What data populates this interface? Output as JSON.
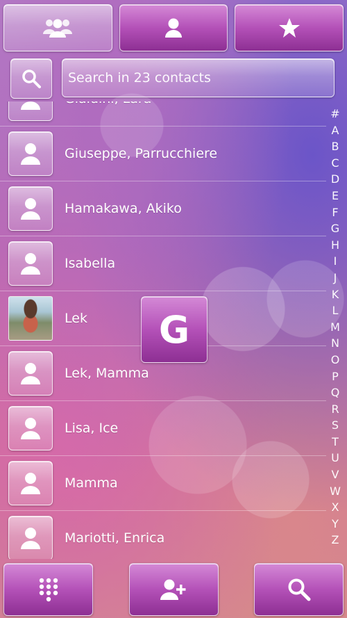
{
  "tabs": [
    {
      "icon": "groups-icon",
      "active": false
    },
    {
      "icon": "contact-icon",
      "active": true
    },
    {
      "icon": "star-icon",
      "active": false
    }
  ],
  "search": {
    "placeholder": "Search in 23 contacts",
    "value": ""
  },
  "contacts": [
    {
      "name": "Gialdini, Lara",
      "photo": false
    },
    {
      "name": "Giuseppe, Parrucchiere",
      "photo": false
    },
    {
      "name": "Hamakawa, Akiko",
      "photo": false
    },
    {
      "name": "Isabella",
      "photo": false
    },
    {
      "name": "Lek",
      "photo": true
    },
    {
      "name": "Lek, Mamma",
      "photo": false
    },
    {
      "name": "Lisa, Ice",
      "photo": false
    },
    {
      "name": "Mamma",
      "photo": false
    },
    {
      "name": "Mariotti, Enrica",
      "photo": false
    }
  ],
  "index": [
    "#",
    "A",
    "B",
    "C",
    "D",
    "E",
    "F",
    "G",
    "H",
    "I",
    "J",
    "K",
    "L",
    "M",
    "N",
    "O",
    "P",
    "Q",
    "R",
    "S",
    "T",
    "U",
    "V",
    "W",
    "X",
    "Y",
    "Z"
  ],
  "overlay_letter": "G",
  "bottom_bar": [
    {
      "icon": "dialpad-icon"
    },
    {
      "icon": "add-contact-icon"
    },
    {
      "icon": "search-icon"
    }
  ]
}
